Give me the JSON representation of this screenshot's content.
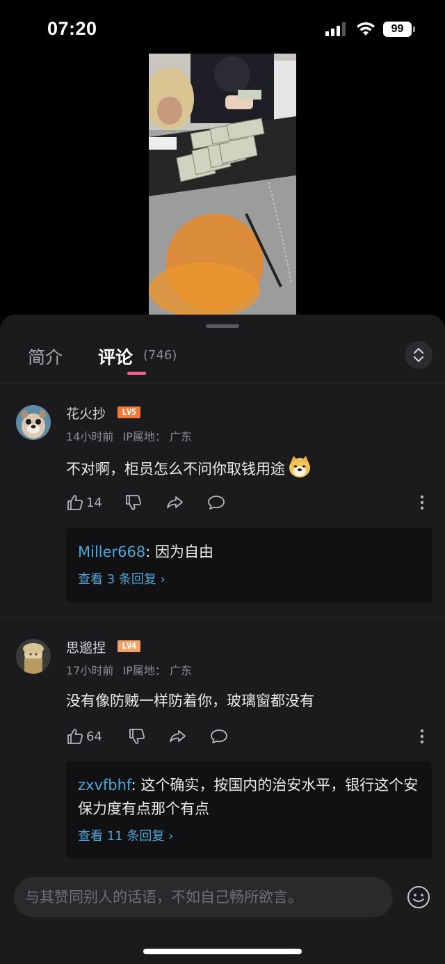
{
  "status_bar": {
    "time": "07:20",
    "battery": "99",
    "icons": [
      "signal-icon",
      "wifi-icon",
      "battery-icon"
    ]
  },
  "tabs": {
    "intro_label": "简介",
    "comments_label": "评论",
    "comments_count": "(746)",
    "active": "comments"
  },
  "comments": [
    {
      "username": "花火抄",
      "level": "LV5",
      "time": "14小时前",
      "ip_label": "IP属地：",
      "ip_location": "广东",
      "text": "不对啊，柜员怎么不问你取钱用途",
      "emoji": "doge",
      "likes": "14",
      "reply_preview_user": "Miller668",
      "reply_preview_text": ": 因为自由",
      "view_replies": "查看 3 条回复 ›"
    },
    {
      "username": "思邈捏",
      "level": "LV4",
      "time": "17小时前",
      "ip_label": "IP属地：",
      "ip_location": "广东",
      "text": "没有像防贼一样防着你，玻璃窗都没有",
      "likes": "64",
      "reply_preview_user": "zxvfbhf",
      "reply_preview_text": ": 这个确实，按国内的治安水平，银行这个安保力度有点那个有点",
      "view_replies": "查看 11 条回复 ›"
    }
  ],
  "input": {
    "placeholder": "与其赞同别人的话语，不如自己畅所欲言。"
  },
  "colors": {
    "accent_pink": "#e9648b",
    "link_blue": "#4fa6d8",
    "sheet_bg": "#1b1b1d"
  }
}
